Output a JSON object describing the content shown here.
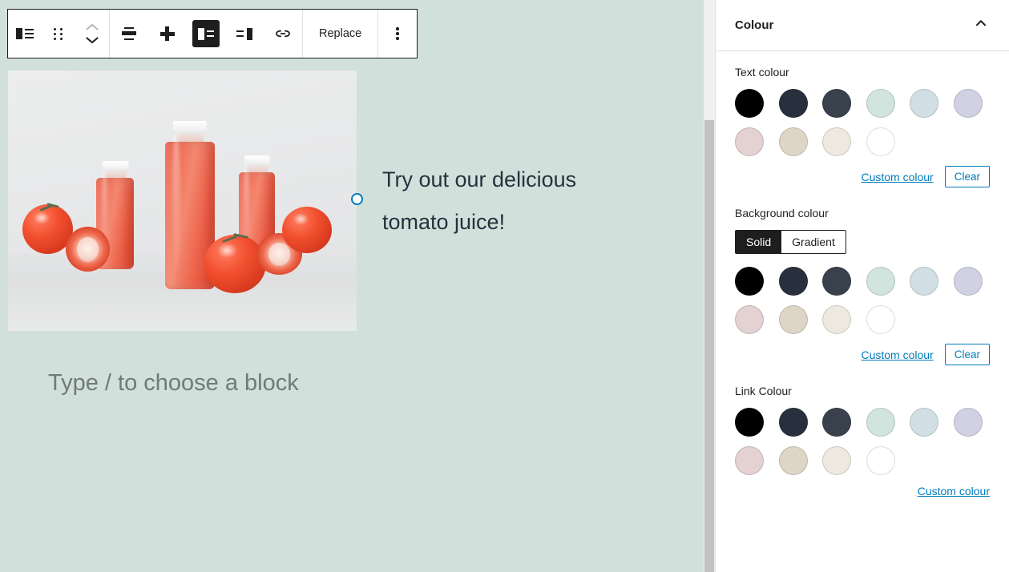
{
  "editor": {
    "canvas_background": "#d1e0da",
    "toolbar": {
      "block_type_icon": "paragraph-media-text-icon",
      "drag_icon": "drag-handle-icon",
      "move_up_icon": "chevron-up-icon",
      "move_down_icon": "chevron-down-icon",
      "align_icon": "align-center-icon",
      "add_icon": "plus-icon",
      "media_right_icon": "show-media-on-left-icon",
      "media_left_icon": "show-media-on-right-icon",
      "link_icon": "link-icon",
      "replace_label": "Replace",
      "more_icon": "more-options-vertical-dots-icon"
    },
    "block": {
      "media_alt": "Three bottles of tomato juice with fresh tomatoes on a light grey surface",
      "text": "Try out our delicious tomato juice!",
      "text_color": "#28303d",
      "resize_handle": "media-resize-handle"
    },
    "empty_paragraph_placeholder": "Type / to choose a block",
    "scrollbar": "vertical-scrollbar"
  },
  "sidebar": {
    "panel": {
      "title": "Colour",
      "collapse_icon": "chevron-up-icon"
    },
    "palette": [
      {
        "name": "Black",
        "hex": "#000000"
      },
      {
        "name": "Dark Grey",
        "hex": "#28303d"
      },
      {
        "name": "Grey",
        "hex": "#39414d"
      },
      {
        "name": "Green",
        "hex": "#d1e4dd"
      },
      {
        "name": "Blue",
        "hex": "#d1dfe4"
      },
      {
        "name": "Purple",
        "hex": "#d1d1e4"
      },
      {
        "name": "Red",
        "hex": "#e4d1d1"
      },
      {
        "name": "Orange",
        "hex": "#ded5c6"
      },
      {
        "name": "Yellow",
        "hex": "#eee9df"
      },
      {
        "name": "White",
        "hex": "#ffffff"
      }
    ],
    "sections": [
      {
        "key": "text_colour",
        "label": "Text colour",
        "custom_label": "Custom colour",
        "clear_label": "Clear",
        "has_clear": true,
        "has_tabs": false
      },
      {
        "key": "background_colour",
        "label": "Background colour",
        "custom_label": "Custom colour",
        "clear_label": "Clear",
        "has_clear": true,
        "has_tabs": true,
        "tabs": [
          {
            "label": "Solid",
            "active": true
          },
          {
            "label": "Gradient",
            "active": false
          }
        ]
      },
      {
        "key": "link_colour",
        "label": "Link Colour",
        "custom_label": "Custom colour",
        "clear_label": "",
        "has_clear": false,
        "has_tabs": false
      }
    ],
    "accent_colour": "#007cba"
  }
}
